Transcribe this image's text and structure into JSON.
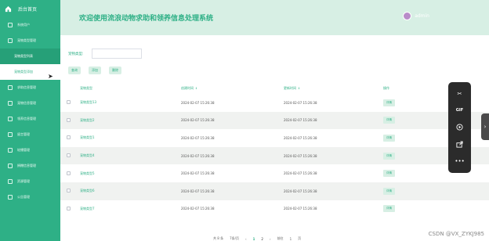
{
  "sidebar": {
    "brand": "后台首页",
    "items": [
      {
        "label": "系统用户",
        "kind": "top"
      },
      {
        "label": "宠物类型管理",
        "kind": "top"
      },
      {
        "label": "宠物类型列表",
        "kind": "active-sub"
      },
      {
        "label": "宠物类型添加",
        "kind": "current"
      },
      {
        "label": "求助信息管理",
        "kind": "top"
      },
      {
        "label": "宠物信息管理",
        "kind": "top"
      },
      {
        "label": "领养信息管理",
        "kind": "top"
      },
      {
        "label": "留言管理",
        "kind": "top"
      },
      {
        "label": "轮播管理",
        "kind": "top"
      },
      {
        "label": "捐赠信息管理",
        "kind": "top"
      },
      {
        "label": "资源管理",
        "kind": "top"
      },
      {
        "label": "公告管理",
        "kind": "top"
      }
    ]
  },
  "header": {
    "title": "欢迎使用流浪动物求助和领养信息处理系统",
    "user": "admin"
  },
  "search": {
    "label": "宠物类型:",
    "value": "",
    "placeholder": ""
  },
  "actions": {
    "search": "查询",
    "add": "添加",
    "delete": "删除"
  },
  "table": {
    "headers": [
      "宠物类型",
      "创建时间",
      "更新时间",
      "操作"
    ],
    "rows": [
      {
        "type": "宠物类型13",
        "created": "2024-02-07 15:26:38",
        "updated": "2024-02-07 15:26:38",
        "action": "详情"
      },
      {
        "type": "宠物类型2",
        "created": "2024-02-07 15:26:38",
        "updated": "2024-02-07 15:26:38",
        "action": "详情"
      },
      {
        "type": "宠物类型1",
        "created": "2024-02-07 15:26:38",
        "updated": "2024-02-07 15:26:38",
        "action": "详情"
      },
      {
        "type": "宠物类型4",
        "created": "2024-02-07 15:26:38",
        "updated": "2024-02-07 15:26:38",
        "action": "详情"
      },
      {
        "type": "宠物类型5",
        "created": "2024-02-07 15:26:38",
        "updated": "2024-02-07 15:26:38",
        "action": "详情"
      },
      {
        "type": "宠物类型6",
        "created": "2024-02-07 15:26:38",
        "updated": "2024-02-07 15:26:38",
        "action": "详情"
      },
      {
        "type": "宠物类型7",
        "created": "2024-02-07 15:26:38",
        "updated": "2024-02-07 15:26:38",
        "action": "详情"
      }
    ]
  },
  "pagination": {
    "total": "共 8 条",
    "per_page": "7条/页",
    "prev": "‹",
    "pages": [
      "1",
      "2"
    ],
    "current_page": "1",
    "next": "›",
    "goto": "前往",
    "goto_value": "1",
    "page_suffix": "页"
  },
  "toolbar": {
    "icons": [
      "scissors-icon",
      "gif-icon",
      "play-icon",
      "share-icon",
      "more-icon"
    ],
    "gif": "GIF",
    "more": "•••"
  },
  "collapse": "›",
  "watermark": "CSDN @VX_ZYKJ985",
  "colors": {
    "primary": "#2eb086",
    "header_bg": "#d7efe4",
    "toolbar": "#2b2b2b"
  }
}
